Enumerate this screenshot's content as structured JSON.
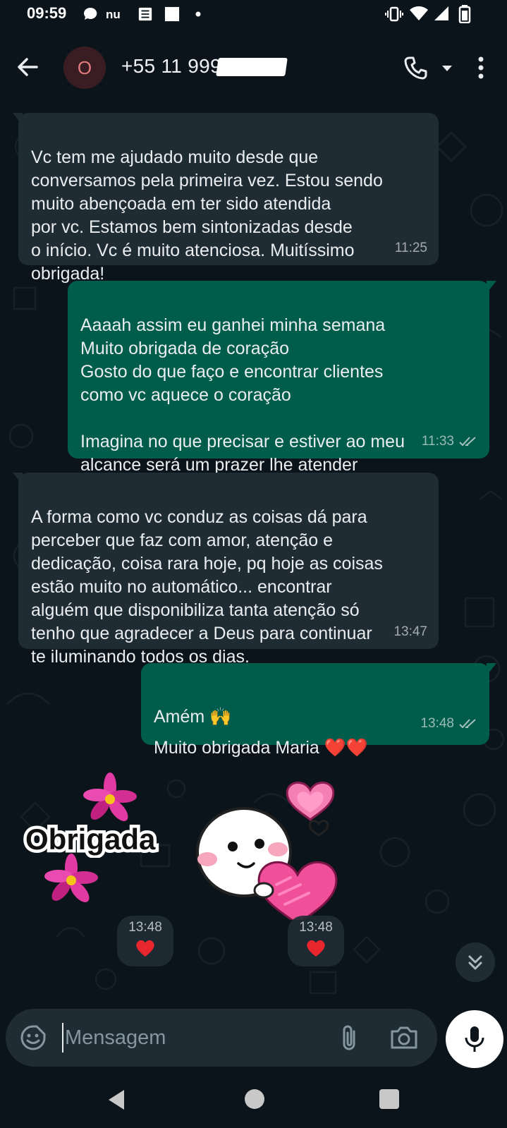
{
  "status_bar": {
    "time": "09:59",
    "notification_icons": [
      "chat-bubble-icon",
      "nubank-icon",
      "news-icon",
      "square-icon",
      "dot-icon"
    ],
    "system_icons": [
      "vibrate-icon",
      "wifi-icon",
      "signal-icon",
      "battery-icon"
    ]
  },
  "header": {
    "avatar_initial": "O",
    "contact_name": "+55 11 999          8",
    "accent_color": "#e07b7b"
  },
  "messages": [
    {
      "direction": "in",
      "text": "Vc tem me ajudado muito desde que\nconversamos pela primeira vez. Estou sendo\nmuito abençoada em ter sido atendida\npor vc. Estamos bem sintonizadas desde\no início. Vc é muito atenciosa. Muitíssimo\nobrigada!",
      "time": "11:25"
    },
    {
      "direction": "out",
      "text": "Aaaah assim eu ganhei minha semana\nMuito obrigada de coração\nGosto do que faço e encontrar clientes\ncomo vc aquece o coração\n\nImagina no que precisar e estiver ao meu\nalcance será um prazer lhe atender",
      "time": "11:33",
      "status": "read"
    },
    {
      "direction": "in",
      "text": "A forma como vc conduz as coisas dá para\nperceber que faz com amor, atenção e\ndedicação, coisa rara hoje, pq hoje as coisas\nestão muito no automático... encontrar\nalguém que disponibiliza tanta  atenção  só\ntenho que agradecer a Deus para   continuar\nte iluminando todos os dias.",
      "time": "13:47"
    },
    {
      "direction": "out",
      "text": "Amém 🙌\nMuito obrigada Maria ❤️❤️",
      "time": "13:48",
      "status": "read"
    }
  ],
  "stickers": [
    {
      "caption": "Obrigada",
      "time": "13:48",
      "reaction": "❤️"
    },
    {
      "caption": "",
      "time": "13:48",
      "reaction": "❤️"
    }
  ],
  "input": {
    "placeholder": "Mensagem"
  },
  "colors": {
    "incoming_bubble": "#202c33",
    "outgoing_bubble": "#005c4b",
    "background": "#0b141a"
  }
}
